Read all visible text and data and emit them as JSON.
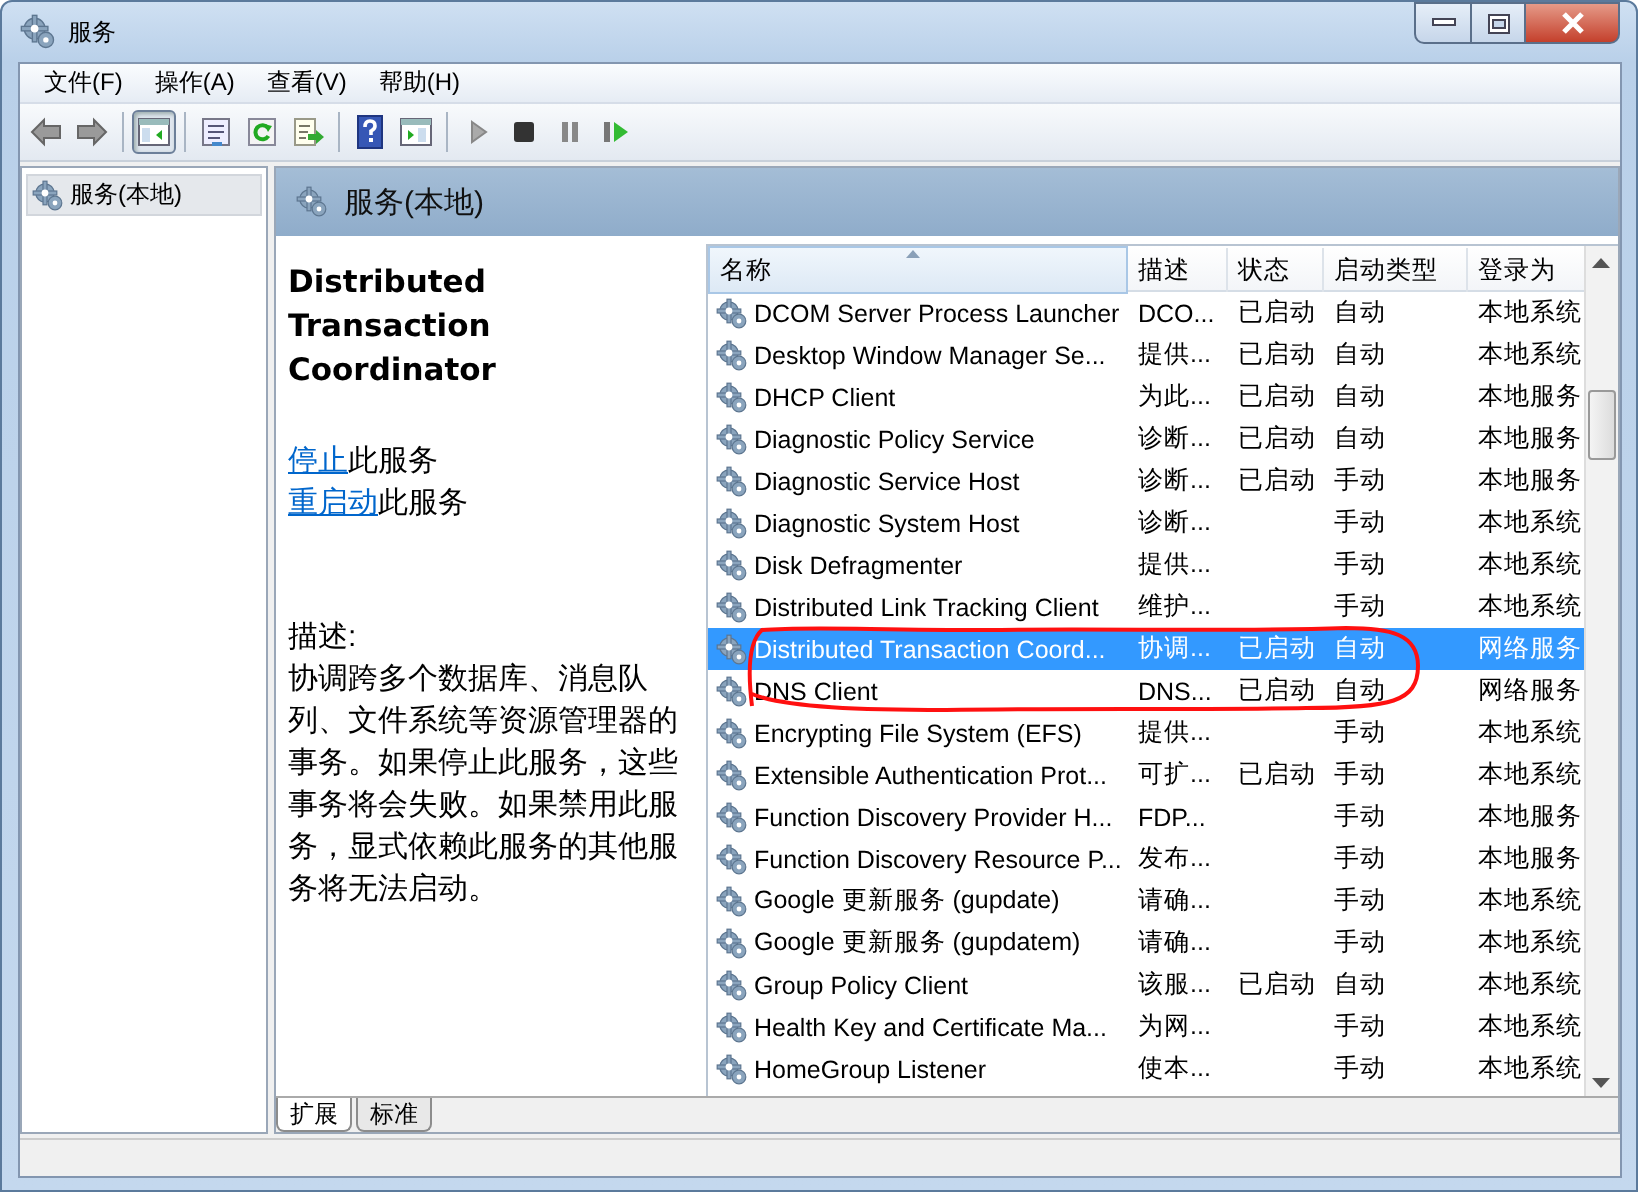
{
  "window": {
    "title": "服务"
  },
  "menu": [
    "文件(F)",
    "操作(A)",
    "查看(V)",
    "帮助(H)"
  ],
  "toolbar": [
    {
      "kind": "back",
      "pressed": false
    },
    {
      "kind": "forward",
      "pressed": false
    },
    {
      "kind": "sep"
    },
    {
      "kind": "tree",
      "pressed": true
    },
    {
      "kind": "sep"
    },
    {
      "kind": "properties",
      "pressed": false
    },
    {
      "kind": "refresh",
      "pressed": false
    },
    {
      "kind": "export",
      "pressed": false
    },
    {
      "kind": "sep"
    },
    {
      "kind": "help",
      "pressed": false
    },
    {
      "kind": "console",
      "pressed": false
    },
    {
      "kind": "sep"
    },
    {
      "kind": "play",
      "pressed": false
    },
    {
      "kind": "stop",
      "pressed": false
    },
    {
      "kind": "pause",
      "pressed": false
    },
    {
      "kind": "resume",
      "pressed": false
    }
  ],
  "tree": {
    "items": [
      {
        "label": "服务(本地)",
        "selected": true
      }
    ]
  },
  "pane_header": "服务(本地)",
  "details": {
    "title": "Distributed Transaction Coordinator",
    "actions": [
      {
        "link": "停止",
        "text": "此服务"
      },
      {
        "link": "重启动",
        "text": "此服务"
      }
    ],
    "description_label": "描述:",
    "description": "协调跨多个数据库、消息队列、文件系统等资源管理器的事务。如果停止此服务，这些事务将会失败。如果禁用此服务，显式依赖此服务的其他服务将无法启动。"
  },
  "table": {
    "columns": [
      {
        "label": "名称",
        "sorted": true
      },
      {
        "label": "描述",
        "sorted": false
      },
      {
        "label": "状态",
        "sorted": false
      },
      {
        "label": "启动类型",
        "sorted": false
      },
      {
        "label": "登录为",
        "sorted": false
      }
    ],
    "rows": [
      {
        "name": "DCOM Server Process Launcher",
        "description": "DCO...",
        "status": "已启动",
        "startup": "自动",
        "logon": "本地系统",
        "selected": false
      },
      {
        "name": "Desktop Window Manager Se...",
        "description": "提供...",
        "status": "已启动",
        "startup": "自动",
        "logon": "本地系统",
        "selected": false
      },
      {
        "name": "DHCP Client",
        "description": "为此...",
        "status": "已启动",
        "startup": "自动",
        "logon": "本地服务",
        "selected": false
      },
      {
        "name": "Diagnostic Policy Service",
        "description": "诊断...",
        "status": "已启动",
        "startup": "自动",
        "logon": "本地服务",
        "selected": false
      },
      {
        "name": "Diagnostic Service Host",
        "description": "诊断...",
        "status": "已启动",
        "startup": "手动",
        "logon": "本地服务",
        "selected": false
      },
      {
        "name": "Diagnostic System Host",
        "description": "诊断...",
        "startup": "手动",
        "logon": "本地系统",
        "selected": false
      },
      {
        "name": "Disk Defragmenter",
        "description": "提供...",
        "startup": "手动",
        "logon": "本地系统",
        "selected": false
      },
      {
        "name": "Distributed Link Tracking Client",
        "description": "维护...",
        "startup": "手动",
        "logon": "本地系统",
        "selected": false
      },
      {
        "name": "Distributed Transaction Coord...",
        "description": "协调...",
        "status": "已启动",
        "startup": "自动",
        "logon": "网络服务",
        "selected": true
      },
      {
        "name": "DNS Client",
        "description": "DNS...",
        "status": "已启动",
        "startup": "自动",
        "logon": "网络服务",
        "selected": false
      },
      {
        "name": "Encrypting File System (EFS)",
        "description": "提供...",
        "startup": "手动",
        "logon": "本地系统",
        "selected": false
      },
      {
        "name": "Extensible Authentication Prot...",
        "description": "可扩...",
        "status": "已启动",
        "startup": "手动",
        "logon": "本地系统",
        "selected": false
      },
      {
        "name": "Function Discovery Provider H...",
        "description": "FDP...",
        "startup": "手动",
        "logon": "本地服务",
        "selected": false
      },
      {
        "name": "Function Discovery Resource P...",
        "description": "发布...",
        "startup": "手动",
        "logon": "本地服务",
        "selected": false
      },
      {
        "name": "Google 更新服务 (gupdate)",
        "description": "请确...",
        "startup": "手动",
        "logon": "本地系统",
        "selected": false
      },
      {
        "name": "Google 更新服务 (gupdatem)",
        "description": "请确...",
        "startup": "手动",
        "logon": "本地系统",
        "selected": false
      },
      {
        "name": "Group Policy Client",
        "description": "该服...",
        "status": "已启动",
        "startup": "自动",
        "logon": "本地系统",
        "selected": false
      },
      {
        "name": "Health Key and Certificate Ma...",
        "description": "为网...",
        "startup": "手动",
        "logon": "本地系统",
        "selected": false
      },
      {
        "name": "HomeGroup Listener",
        "description": "使本...",
        "startup": "手动",
        "logon": "本地系统",
        "selected": false
      }
    ]
  },
  "view_tabs": [
    {
      "label": "扩展",
      "selected": true
    },
    {
      "label": "标准",
      "selected": false
    }
  ],
  "annotation": {
    "kind": "freehand-circle"
  }
}
